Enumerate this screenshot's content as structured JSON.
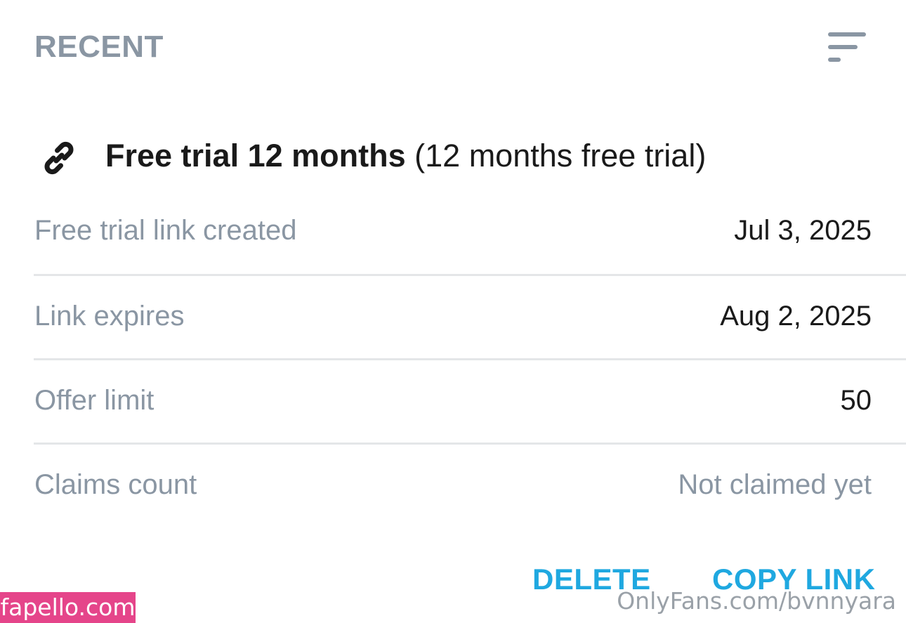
{
  "header": {
    "title": "RECENT",
    "sort_icon": "sort-lines-icon"
  },
  "offer": {
    "icon": "link-icon",
    "name": "Free trial 12 months",
    "description": "(12 months free trial)"
  },
  "details": [
    {
      "label": "Free trial link created",
      "value": "Jul 3, 2025"
    },
    {
      "label": "Link expires",
      "value": "Aug 2, 2025"
    },
    {
      "label": "Offer limit",
      "value": "50"
    },
    {
      "label": "Claims count",
      "value": "Not claimed yet"
    }
  ],
  "actions": {
    "delete_label": "DELETE",
    "copy_label": "COPY LINK"
  },
  "watermarks": {
    "left": "fapello.com",
    "right": "OnlyFans.com/bvnnyara"
  },
  "colors": {
    "accent": "#1fa8e0",
    "muted_text": "#8a96a3",
    "primary_text": "#1a1a1a",
    "divider": "#e4e6e8",
    "watermark_badge": "#e5458a"
  }
}
